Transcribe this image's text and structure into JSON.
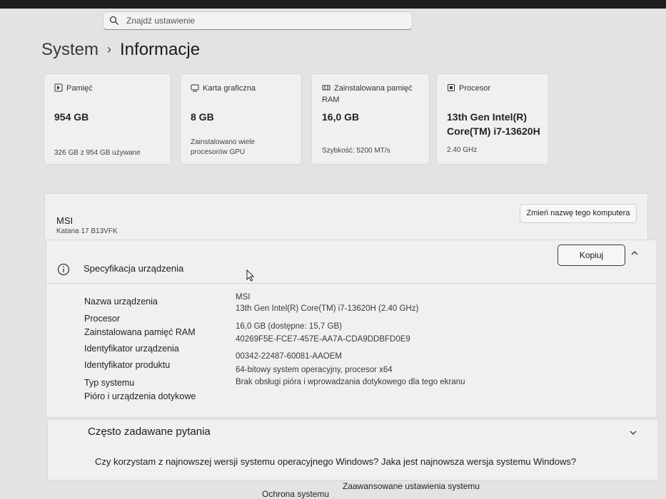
{
  "search": {
    "placeholder": "Znajdź ustawienie"
  },
  "breadcrumb": {
    "parent": "System",
    "separator": "›",
    "current": "Informacje"
  },
  "cards": [
    {
      "label": "Pamięć",
      "value": "954 GB",
      "sub": "326 GB z 954 GB używane",
      "icon": "storage-icon"
    },
    {
      "label": "Karta graficzna",
      "value": "8 GB",
      "sub": "Zainstalowano wiele procesorów GPU",
      "icon": "gpu-icon"
    },
    {
      "label": "Zainstalowana pamięć RAM",
      "value": "16,0 GB",
      "sub": "Szybkość: 5200 MT/s",
      "icon": "ram-icon"
    },
    {
      "label": "Procesor",
      "value": "13th Gen Intel(R) Core(TM) i7-13620H",
      "sub": "2.40 GHz",
      "icon": "cpu-icon"
    }
  ],
  "device": {
    "name": "MSI",
    "model": "Katana 17 B13VFK",
    "rename_label": "Zmień nazwę tego komputera"
  },
  "specs": {
    "header": "Specyfikacja urządzenia",
    "copy_label": "Kopiuj",
    "rows": [
      {
        "label": "Nazwa urządzenia",
        "value": "MSI"
      },
      {
        "label": "Procesor",
        "value": "13th Gen Intel(R) Core(TM) i7-13620H (2.40 GHz)"
      },
      {
        "label": "Zainstalowana pamięć RAM",
        "value": "16,0 GB (dostępne: 15,7 GB)"
      },
      {
        "label": "Identyfikator urządzenia",
        "value": "40269F5E-FCE7-457E-AA7A-CDA9DDBFD0E9"
      },
      {
        "label": "Identyfikator produktu",
        "value": "00342-22487-60081-AAOEM"
      },
      {
        "label": "Typ systemu",
        "value": "64-bitowy system operacyjny, procesor x64"
      },
      {
        "label": "Pióro i urządzenia dotykowe",
        "value": "Brak obsługi pióra i wprowadzania dotykowego dla tego ekranu"
      }
    ]
  },
  "faq": {
    "title": "Często zadawane pytania",
    "question": "Czy korzystam z najnowszej wersji systemu operacyjnego Windows? Jaka jest najnowsza wersja systemu Windows?"
  },
  "links": {
    "protection": "Ochrona systemu",
    "advanced": "Zaawansowane ustawienia systemu"
  },
  "colors": {
    "background": "#e3e3e5",
    "card": "#f0f0f1",
    "text": "#1c1c1c"
  }
}
